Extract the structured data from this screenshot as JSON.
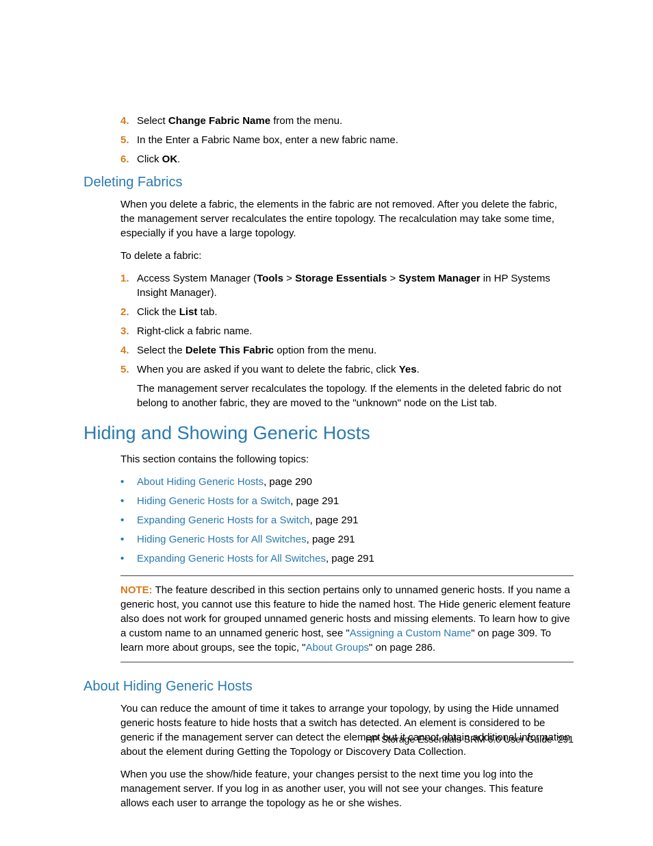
{
  "topList": {
    "items": [
      {
        "num": "4.",
        "pre": "Select ",
        "b1": "Change Fabric Name",
        "post": " from the menu."
      },
      {
        "num": "5.",
        "text": "In the Enter a Fabric Name box, enter a new fabric name."
      },
      {
        "num": "6.",
        "pre": "Click ",
        "b1": "OK",
        "post": "."
      }
    ]
  },
  "deleting": {
    "heading": "Deleting Fabrics",
    "p1": "When you delete a fabric, the elements in the fabric are not removed. After you delete the fabric, the management server recalculates the entire topology. The recalculation may take some time, especially if you have a large topology.",
    "p2": "To delete a fabric:",
    "items": [
      {
        "num": "1.",
        "pre": "Access System Manager (",
        "b1": "Tools",
        "mid1": " > ",
        "b2": "Storage Essentials",
        "mid2": " > ",
        "b3": "System Manager",
        "post": " in HP Systems Insight Manager)."
      },
      {
        "num": "2.",
        "pre": "Click the ",
        "b1": "List",
        "post": " tab."
      },
      {
        "num": "3.",
        "text": "Right-click a fabric name."
      },
      {
        "num": "4.",
        "pre": "Select the ",
        "b1": "Delete This Fabric",
        "post": " option from the menu."
      },
      {
        "num": "5.",
        "pre": "When you are asked if you want to delete the fabric, click ",
        "b1": "Yes",
        "post": ".",
        "sub": "The management server recalculates the topology. If the elements in the deleted fabric do not belong to another fabric, they are moved to the \"unknown\" node on the List tab."
      }
    ]
  },
  "hiding": {
    "heading": "Hiding and Showing Generic Hosts",
    "intro": "This section contains the following topics:",
    "links": [
      {
        "label": "About Hiding Generic Hosts",
        "page": ", page 290"
      },
      {
        "label": "Hiding Generic Hosts for a Switch",
        "page": ", page 291"
      },
      {
        "label": "Expanding Generic Hosts for a Switch",
        "page": ", page 291"
      },
      {
        "label": "Hiding Generic Hosts for All Switches",
        "page": ", page 291"
      },
      {
        "label": "Expanding Generic Hosts for All Switches",
        "page": ", page 291"
      }
    ]
  },
  "note": {
    "label": "NOTE:",
    "t1": "   The feature described in this section pertains only to unnamed generic hosts. If you name a generic host, you cannot use this feature to hide the named host. The Hide generic element feature also does not work for grouped unnamed generic hosts and missing elements. To learn how to give a custom name to an unnamed generic host, see \"",
    "link1": "Assigning a Custom Name",
    "t2": "\" on page 309. To learn more about groups, see the topic, \"",
    "link2": "About Groups",
    "t3": "\" on page 286."
  },
  "about": {
    "heading": "About Hiding Generic Hosts",
    "p1": "You can reduce the amount of time it takes to arrange your topology, by using the Hide unnamed generic hosts feature to hide hosts that a switch has detected. An element is considered to be generic if the management server can detect the element but it cannot obtain additional information about the element during Getting the Topology or Discovery Data Collection.",
    "p2": "When you use the show/hide feature, your changes persist to the next time you log into the management server. If you log in as another user, you will not see your changes. This feature allows each user to arrange the topology as he or she wishes."
  },
  "footer": {
    "title": "HP Storage Essentials SRM 6.0 User Guide",
    "page": "291"
  }
}
